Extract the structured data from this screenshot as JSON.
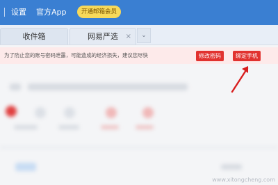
{
  "topbar": {
    "settings": "设置",
    "official_app": "官方App",
    "vip_button": "开通邮箱会员"
  },
  "tabs": [
    {
      "label": "收件箱"
    },
    {
      "label": "网易严选",
      "close": "×"
    }
  ],
  "tab_dropdown": "⌄",
  "warning": {
    "text": "为了防止您的账号密码泄露，可能造成的经济损失，建议您尽快",
    "change_password": "修改密码",
    "bind_phone": "绑定手机"
  },
  "watermark": "www.xitongcheng.com",
  "colors": {
    "brand": "#3a7fd2",
    "alert": "#e1322f",
    "vip": "#f7d95a"
  }
}
